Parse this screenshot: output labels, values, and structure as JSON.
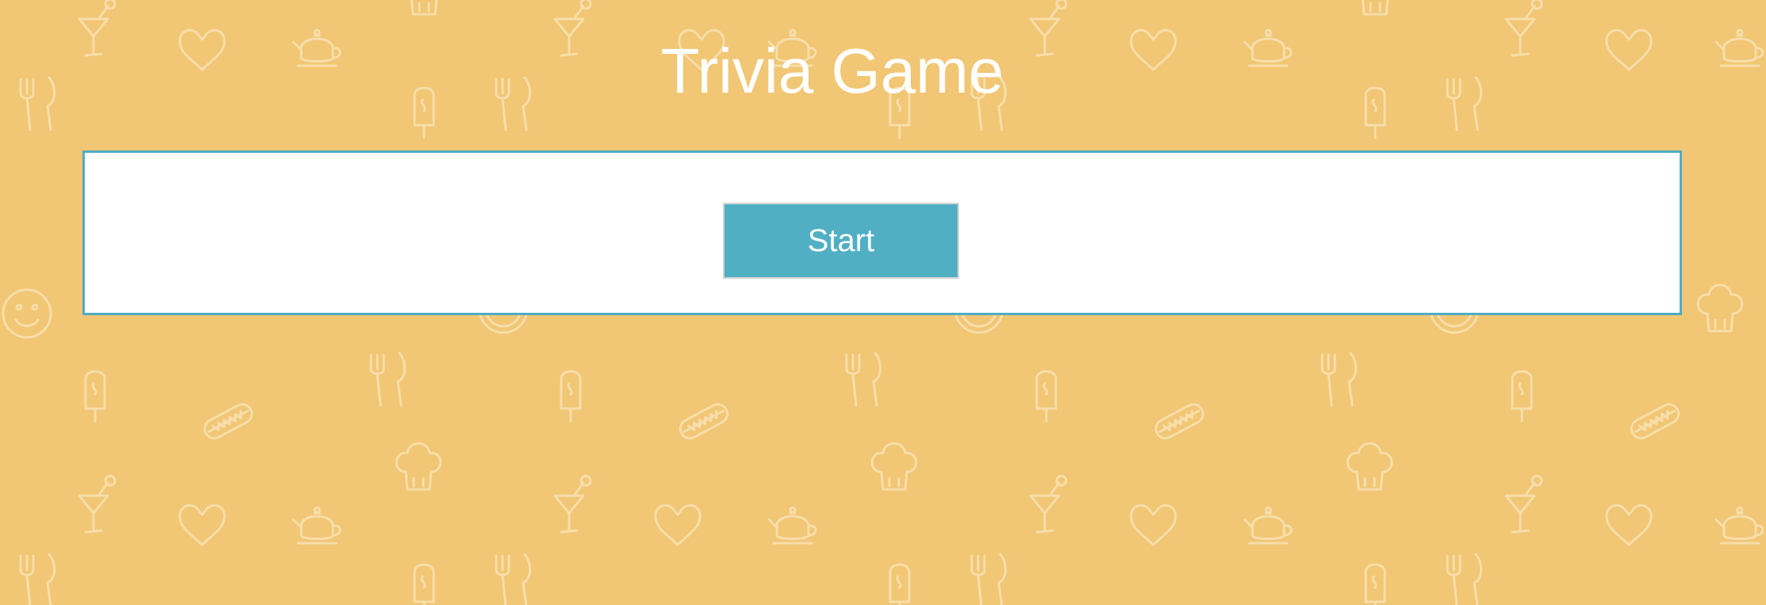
{
  "title": "Trivia Game",
  "start_label": "Start",
  "colors": {
    "background": "#f1c674",
    "pattern": "#f6dca6",
    "panel": "#ffffff",
    "panel_border": "#4eadc4",
    "button": "#51afc4",
    "text": "#ffffff"
  },
  "background_icons": [
    "cocktail-icon",
    "heart-icon",
    "teapot-icon",
    "fork-knife-icon",
    "popsicle-icon",
    "chef-hat-icon",
    "hot-dog-icon",
    "smiley-icon",
    "plate-icon"
  ]
}
